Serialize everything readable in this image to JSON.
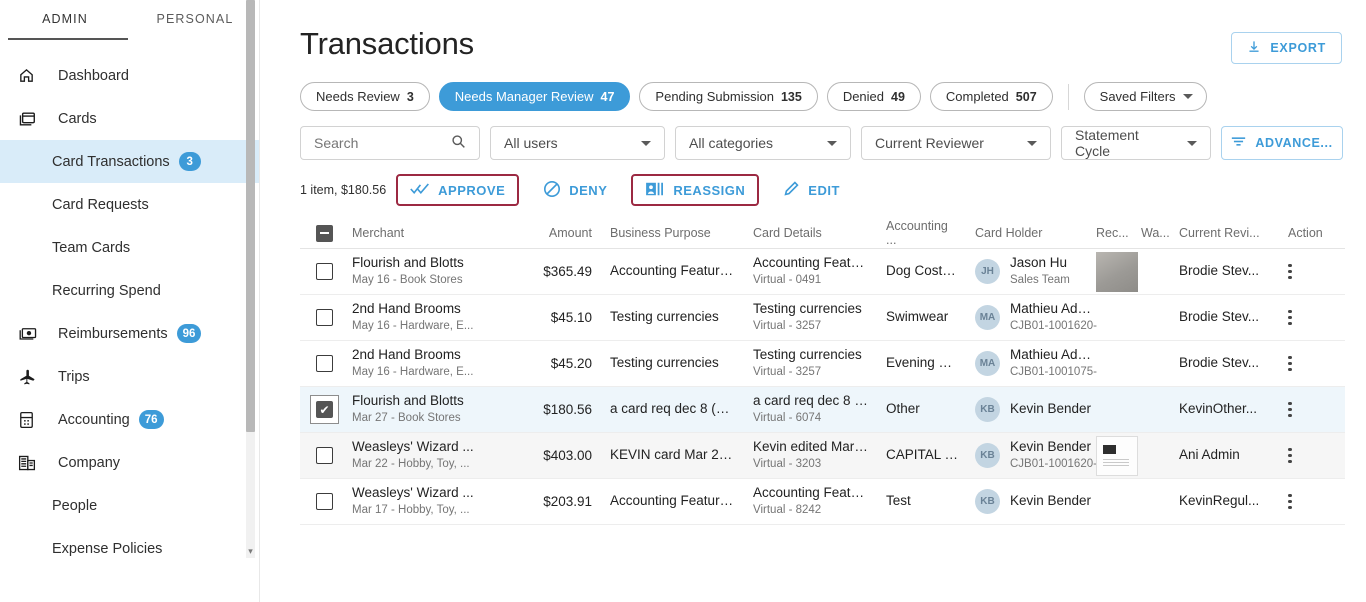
{
  "sidebar": {
    "tabs": [
      {
        "label": "ADMIN",
        "active": true
      },
      {
        "label": "PERSONAL",
        "active": false
      }
    ],
    "items": [
      {
        "label": "Dashboard",
        "icon": "home-icon",
        "badge": "",
        "active": false,
        "sub": false
      },
      {
        "label": "Cards",
        "icon": "cards-icon",
        "badge": "",
        "active": false,
        "sub": false
      },
      {
        "label": "Card Transactions",
        "icon": "",
        "badge": "3",
        "active": true,
        "sub": true
      },
      {
        "label": "Card Requests",
        "icon": "",
        "badge": "",
        "active": false,
        "sub": true
      },
      {
        "label": "Team Cards",
        "icon": "",
        "badge": "",
        "active": false,
        "sub": true
      },
      {
        "label": "Recurring Spend",
        "icon": "",
        "badge": "",
        "active": false,
        "sub": true
      },
      {
        "label": "Reimbursements",
        "icon": "money-icon",
        "badge": "96",
        "active": false,
        "sub": false
      },
      {
        "label": "Trips",
        "icon": "plane-icon",
        "badge": "",
        "active": false,
        "sub": false
      },
      {
        "label": "Accounting",
        "icon": "calculator-icon",
        "badge": "76",
        "active": false,
        "sub": false
      },
      {
        "label": "Company",
        "icon": "building-icon",
        "badge": "",
        "active": false,
        "sub": false
      },
      {
        "label": "People",
        "icon": "",
        "badge": "",
        "active": false,
        "sub": true
      },
      {
        "label": "Expense Policies",
        "icon": "",
        "badge": "",
        "active": false,
        "sub": true
      }
    ]
  },
  "header": {
    "title": "Transactions",
    "export_label": "EXPORT"
  },
  "chips": [
    {
      "label": "Needs Review",
      "count": "3",
      "active": false
    },
    {
      "label": "Needs Manager Review",
      "count": "47",
      "active": true
    },
    {
      "label": "Pending Submission",
      "count": "135",
      "active": false
    },
    {
      "label": "Denied",
      "count": "49",
      "active": false
    },
    {
      "label": "Completed",
      "count": "507",
      "active": false
    }
  ],
  "saved_filters": {
    "label": "Saved Filters"
  },
  "filters": {
    "search_placeholder": "Search",
    "users": "All users",
    "categories": "All categories",
    "reviewer": "Current Reviewer",
    "cycle": "Statement Cycle",
    "advanced": "ADVANCE..."
  },
  "actions": {
    "summary": "1 item, $180.56",
    "approve": "APPROVE",
    "deny": "DENY",
    "reassign": "REASSIGN",
    "edit": "EDIT"
  },
  "table": {
    "columns": {
      "merchant": "Merchant",
      "amount": "Amount",
      "purpose": "Business Purpose",
      "card": "Card Details",
      "accounting": "Accounting ...",
      "holder": "Card Holder",
      "receipt": "Rec...",
      "warning": "Wa...",
      "reviewer": "Current Revi...",
      "action": "Action"
    },
    "rows": [
      {
        "checked": false,
        "highlight": "none",
        "merchant": "Flourish and Blotts",
        "merchant_sub": "May 16 - Book Stores",
        "amount": "$365.49",
        "purpose": "Accounting Feature...",
        "card": "Accounting Feature...",
        "card_sub": "Virtual - 0491",
        "accounting": "Dog Costu...",
        "holder_initials": "JH",
        "holder": "Jason Hu",
        "holder_sub": "Sales Team",
        "receipt": "photo",
        "reviewer": "Brodie Stev..."
      },
      {
        "checked": false,
        "highlight": "none",
        "merchant": "2nd Hand Brooms",
        "merchant_sub": "May 16 - Hardware, E...",
        "amount": "$45.10",
        "purpose": "Testing currencies",
        "card": "Testing currencies",
        "card_sub": "Virtual - 3257",
        "accounting": "Swimwear",
        "holder_initials": "MA",
        "holder": "Mathieu Admin",
        "holder_sub": "CJB01-1001620-",
        "receipt": "none",
        "reviewer": "Brodie Stev..."
      },
      {
        "checked": false,
        "highlight": "none",
        "merchant": "2nd Hand Brooms",
        "merchant_sub": "May 16 - Hardware, E...",
        "amount": "$45.20",
        "purpose": "Testing currencies",
        "card": "Testing currencies",
        "card_sub": "Virtual - 3257",
        "accounting": "Evening W...",
        "holder_initials": "MA",
        "holder": "Mathieu Admin",
        "holder_sub": "CJB01-1001075-",
        "receipt": "none",
        "reviewer": "Brodie Stev..."
      },
      {
        "checked": true,
        "highlight": "selected",
        "merchant": "Flourish and Blotts",
        "merchant_sub": "Mar 27 - Book Stores",
        "amount": "$180.56",
        "purpose": "a card req dec 8 (ed...",
        "card": "a card req dec 8 (ed...",
        "card_sub": "Virtual - 6074",
        "accounting": "Other",
        "holder_initials": "KB",
        "holder": "Kevin Bender",
        "holder_sub": "",
        "receipt": "none",
        "reviewer": "KevinOther..."
      },
      {
        "checked": false,
        "highlight": "alt",
        "merchant": "Weasleys' Wizard ...",
        "merchant_sub": "Mar 22 - Hobby, Toy, ...",
        "amount": "$403.00",
        "purpose": "KEVIN card Mar 22...",
        "card": "Kevin edited March...",
        "card_sub": "Virtual - 3203",
        "accounting": "CAPITAL C...",
        "holder_initials": "KB",
        "holder": "Kevin Bender",
        "holder_sub": "CJB01-1001620-",
        "receipt": "doc",
        "reviewer": "Ani Admin"
      },
      {
        "checked": false,
        "highlight": "none",
        "merchant": "Weasleys' Wizard ...",
        "merchant_sub": "Mar 17 - Hobby, Toy, ...",
        "amount": "$203.91",
        "purpose": "Accounting Feature...",
        "card": "Accounting Feature...",
        "card_sub": "Virtual - 8242",
        "accounting": "Test",
        "holder_initials": "KB",
        "holder": "Kevin Bender",
        "holder_sub": "",
        "receipt": "none",
        "reviewer": "KevinRegul..."
      }
    ]
  },
  "colors": {
    "accent": "#3d9bd8",
    "active_row": "#eef6fb",
    "sidebar_active": "#d9ecf9",
    "outline_red": "#9c2942"
  }
}
